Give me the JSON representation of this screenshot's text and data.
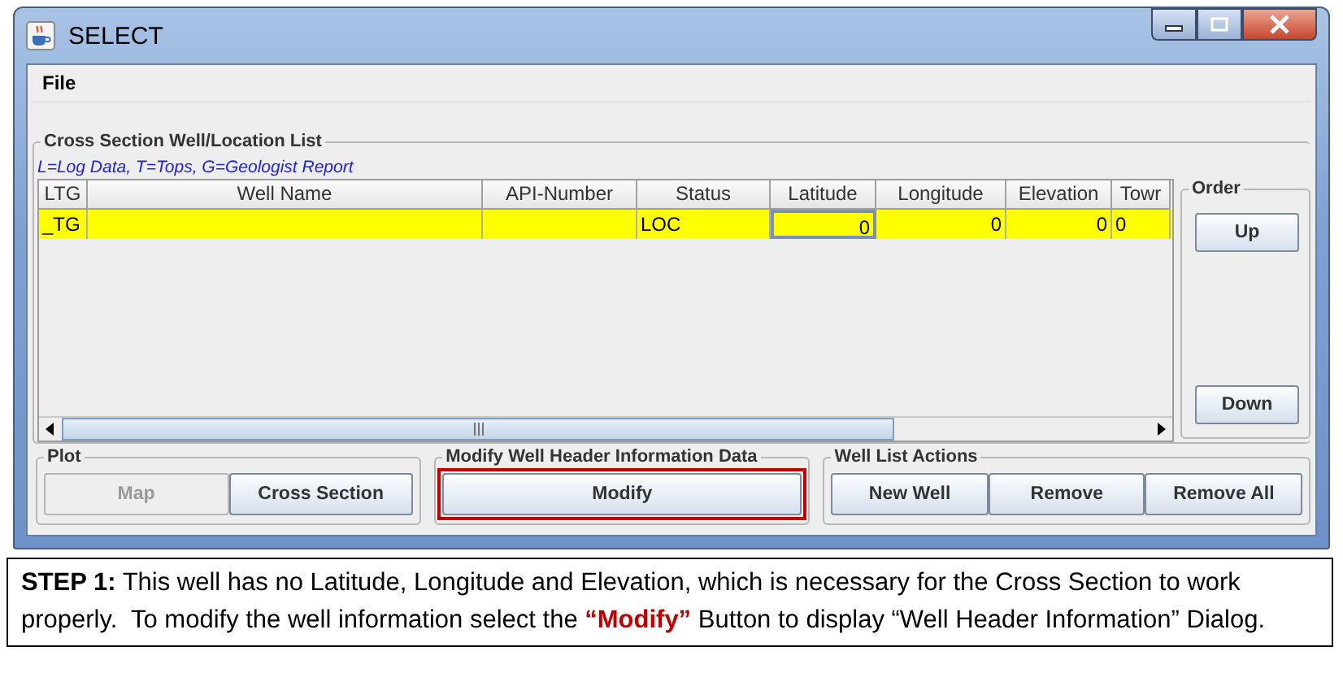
{
  "window": {
    "title": "SELECT"
  },
  "menu": [
    "File"
  ],
  "list_group": {
    "title": "Cross Section Well/Location List",
    "legend": "L=Log Data, T=Tops, G=Geologist Report",
    "columns": [
      "LTG",
      "Well Name",
      "API-Number",
      "Status",
      "Latitude",
      "Longitude",
      "Elevation",
      "Towr"
    ],
    "rows": [
      {
        "selected": true,
        "cells": [
          {
            "text": "_TG"
          },
          {},
          {},
          {
            "text": "LOC"
          },
          {
            "text": "0",
            "focused": true
          },
          {
            "text": "0"
          },
          {
            "text": "0"
          },
          {
            "text": "0"
          }
        ]
      }
    ]
  },
  "order_group": {
    "title": "Order",
    "buttons": [
      {
        "label": "Up",
        "disabled": false
      },
      {
        "label": "Down",
        "disabled": false
      }
    ]
  },
  "button_groups": [
    {
      "title": "Plot",
      "highlighted": false,
      "buttons": [
        {
          "label": "Map",
          "disabled": true
        },
        {
          "label": "Cross Section",
          "disabled": false
        }
      ]
    },
    {
      "title": "Modify Well Header Information Data",
      "highlighted": true,
      "buttons": [
        {
          "label": "Modify",
          "disabled": false
        }
      ]
    },
    {
      "title": "Well List Actions",
      "highlighted": false,
      "buttons": [
        {
          "label": "New Well",
          "disabled": false
        },
        {
          "label": "Remove",
          "disabled": false
        },
        {
          "label": "Remove All",
          "disabled": false
        }
      ]
    }
  ],
  "caption": [
    {
      "kind": "lead",
      "text": "STEP 1:"
    },
    {
      "kind": "plain",
      "text": " This well has no Latitude, Longitude and Elevation, which is necessary for the Cross Section to work properly.  To modify the well information select the "
    },
    {
      "kind": "highlight",
      "text": "“Modify”"
    },
    {
      "kind": "plain",
      "text": " Button to display “Well Header Information” Dialog."
    }
  ]
}
